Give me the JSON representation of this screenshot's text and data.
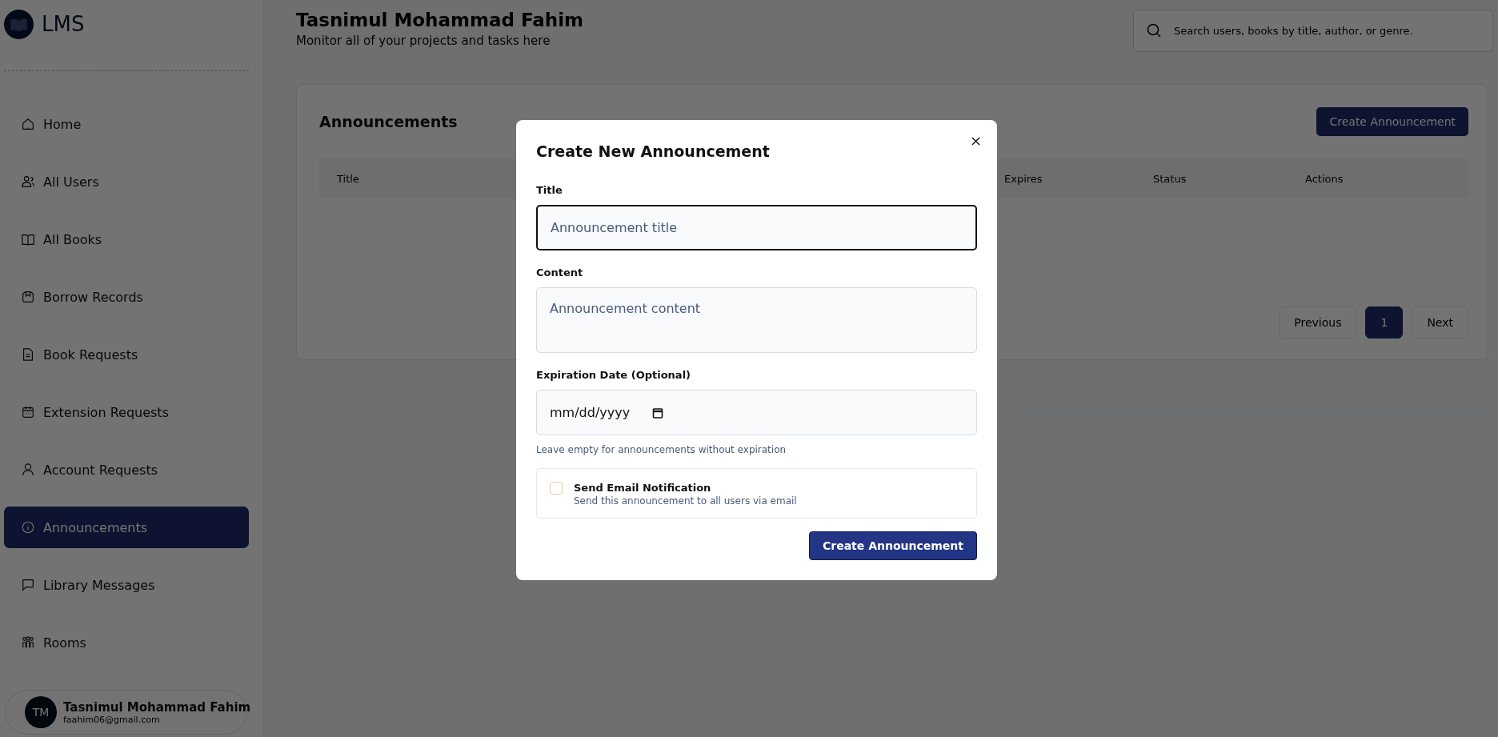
{
  "sidebar": {
    "logo": "LMS",
    "items": [
      {
        "label": "Home",
        "selected": false
      },
      {
        "label": "All Users",
        "selected": false
      },
      {
        "label": "All Books",
        "selected": false
      },
      {
        "label": "Borrow Records",
        "selected": false
      },
      {
        "label": "Book Requests",
        "selected": false
      },
      {
        "label": "Extension Requests",
        "selected": false
      },
      {
        "label": "Account Requests",
        "selected": false
      },
      {
        "label": "Announcements",
        "selected": true
      },
      {
        "label": "Library Messages",
        "selected": false
      },
      {
        "label": "Rooms",
        "selected": false
      }
    ],
    "user": {
      "initials": "TM",
      "name": "Tasnimul Mohammad Fahim",
      "email": "faahim06@gmail.com"
    }
  },
  "header": {
    "title": "Tasnimul Mohammad Fahim",
    "subtitle": "Monitor all of your projects and tasks here",
    "search": {
      "placeholder": "Search users, books by title, author, or genre."
    }
  },
  "card": {
    "title": "Announcements",
    "create_button": "Create Announcement",
    "table": {
      "columns": [
        "Title",
        "Expires",
        "Status",
        "Actions"
      ]
    },
    "pagination": [
      {
        "label": "Previous",
        "selected": false
      },
      {
        "label": "1",
        "selected": true
      },
      {
        "label": "Next",
        "selected": false
      }
    ]
  },
  "modal": {
    "title": "Create New Announcement",
    "fields": [
      {
        "kind": "text",
        "label": "Title",
        "placeholder": "Announcement title",
        "focused": true
      },
      {
        "kind": "textarea",
        "label": "Content",
        "placeholder": "Announcement content",
        "focused": false
      },
      {
        "kind": "date",
        "label": "Expiration Date (Optional)",
        "placeholder": "mm/dd/yyyy",
        "hint": "Leave empty for announcements without expiration",
        "focused": false
      }
    ],
    "email_option": {
      "label": "Send Email Notification",
      "description": "Send this announcement to all users via email",
      "checked": false
    },
    "submit": "Create Announcement"
  }
}
